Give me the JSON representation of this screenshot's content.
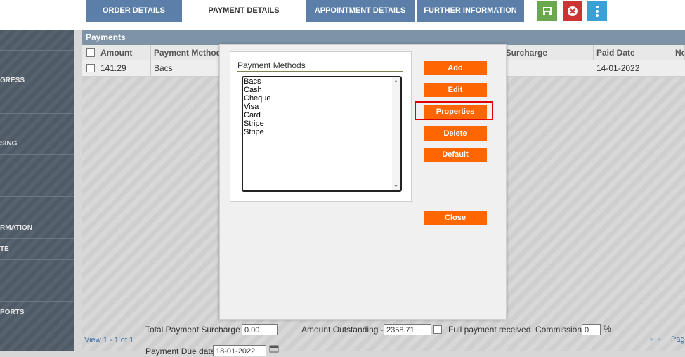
{
  "tabs": [
    {
      "label": "ORDER DETAILS"
    },
    {
      "label": "PAYMENT DETAILS"
    },
    {
      "label": "APPOINTMENT DETAILS"
    },
    {
      "label": "FURTHER INFORMATION"
    }
  ],
  "toolbar": {
    "save_icon": "save-icon",
    "cancel_icon": "close-icon",
    "more_icon": "kebab-menu-icon",
    "save_color": "#6aa84f",
    "cancel_color": "#cc3333",
    "more_color": "#3aa0d8"
  },
  "sidebar": {
    "items": [
      {
        "label": "GRESS"
      },
      {
        "label": "SING"
      },
      {
        "label": "RMATION"
      },
      {
        "label": "TE"
      },
      {
        "label": "PORTS"
      }
    ]
  },
  "payments": {
    "title": "Payments",
    "columns": [
      "Amount",
      "Payment Method",
      "d Surcharge",
      "Paid Date",
      "No"
    ],
    "rows": [
      {
        "amount": "141.29",
        "method": "Bacs",
        "paid_date": "14-01-2022"
      }
    ]
  },
  "footer": {
    "view_text": "View 1 - 1 of 1",
    "total_surcharge_label": "Total Payment Surcharge -",
    "total_surcharge_value": "0.00",
    "amount_outstanding_label": "Amount Outstanding -",
    "amount_outstanding_value": "2358.71",
    "full_payment_label": "Full payment received",
    "commission_label": "Commission",
    "commission_value": "0",
    "percent": "%",
    "pager_text": "Page",
    "due_date_label": "Payment Due date",
    "due_date_value": "18-01-2022"
  },
  "modal": {
    "group_title": "Payment Methods",
    "methods": [
      "Bacs",
      "Cash",
      "Cheque",
      "Visa",
      "Card",
      "Stripe",
      "Stripe"
    ],
    "buttons": {
      "add": "Add",
      "edit": "Edit",
      "properties": "Properties",
      "delete": "Delete",
      "default": "Default",
      "close": "Close"
    },
    "accent_color": "#ff6600",
    "highlight_color": "#e00000"
  }
}
